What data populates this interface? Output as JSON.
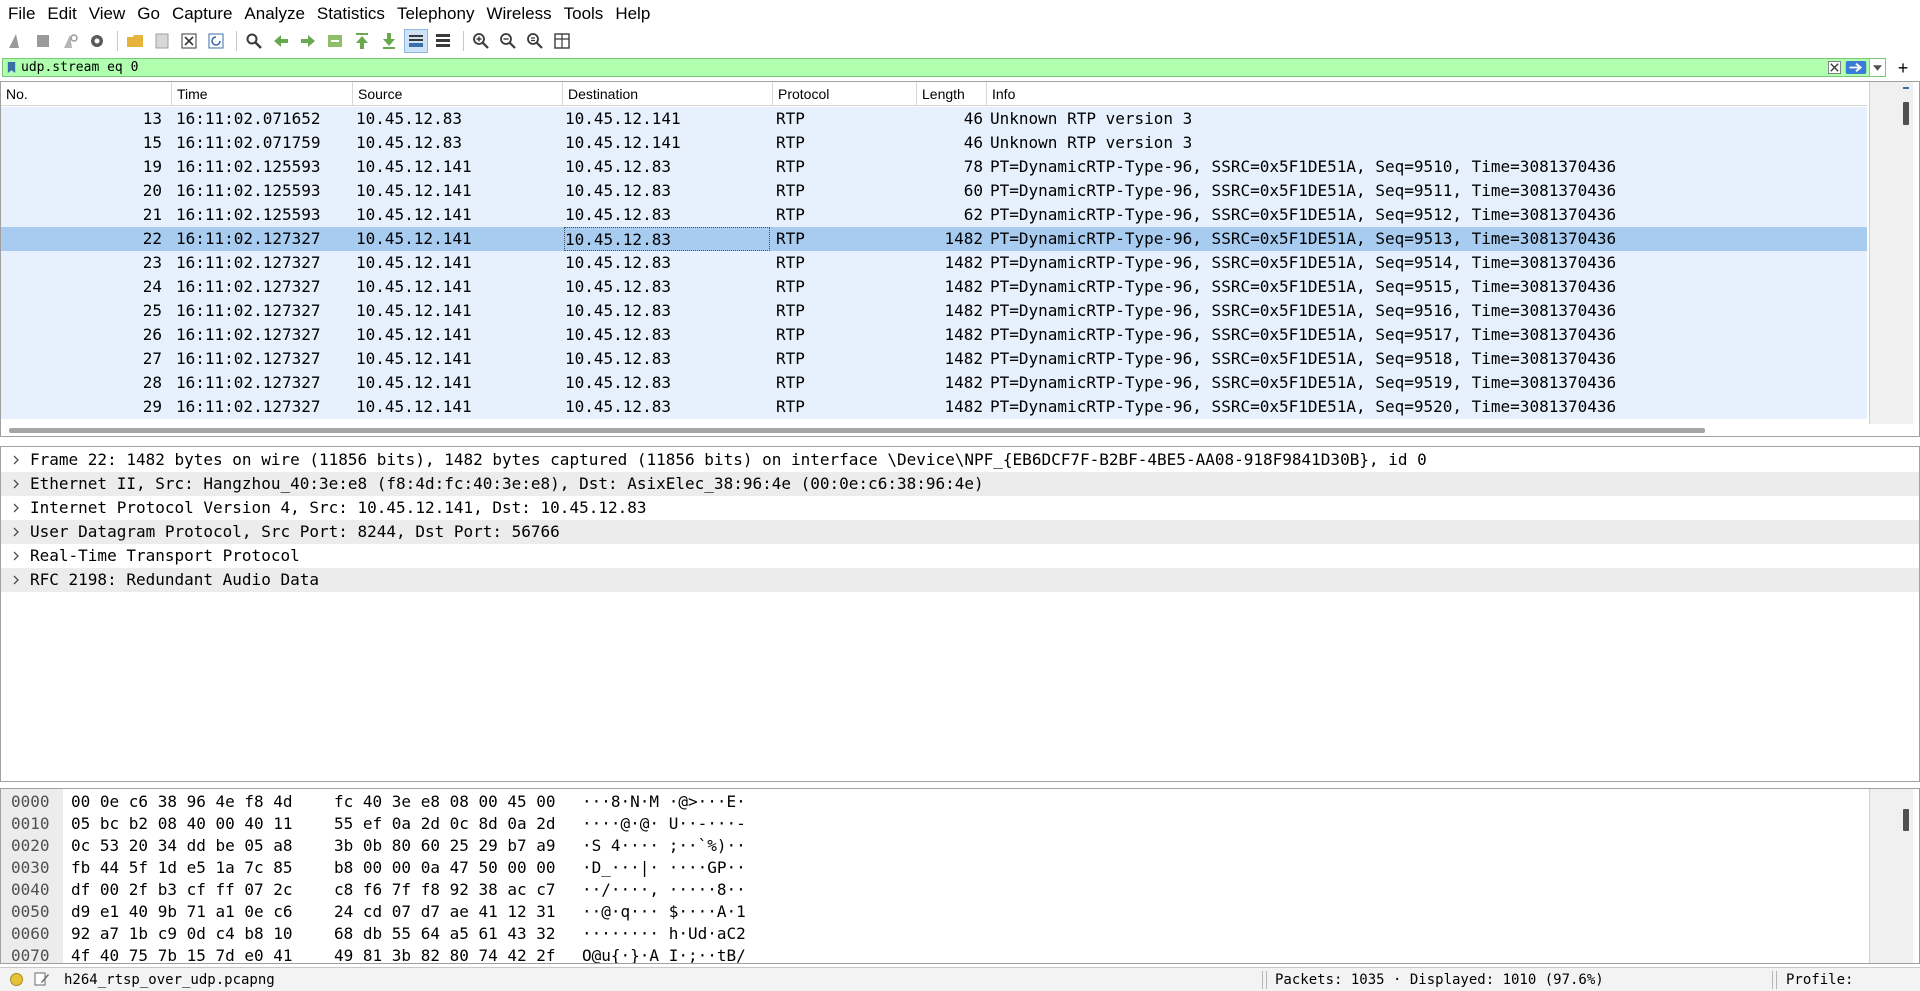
{
  "menu": [
    "File",
    "Edit",
    "View",
    "Go",
    "Capture",
    "Analyze",
    "Statistics",
    "Telephony",
    "Wireless",
    "Tools",
    "Help"
  ],
  "filter": {
    "value": "udp.stream eq 0"
  },
  "columns": {
    "no": "No.",
    "time": "Time",
    "source": "Source",
    "destination": "Destination",
    "protocol": "Protocol",
    "length": "Length",
    "info": "Info"
  },
  "packets": [
    {
      "no": "13",
      "time": "16:11:02.071652",
      "source": "10.45.12.83",
      "destination": "10.45.12.141",
      "protocol": "RTP",
      "length": "46",
      "info": "Unknown RTP version 3"
    },
    {
      "no": "15",
      "time": "16:11:02.071759",
      "source": "10.45.12.83",
      "destination": "10.45.12.141",
      "protocol": "RTP",
      "length": "46",
      "info": "Unknown RTP version 3"
    },
    {
      "no": "19",
      "time": "16:11:02.125593",
      "source": "10.45.12.141",
      "destination": "10.45.12.83",
      "protocol": "RTP",
      "length": "78",
      "info": "PT=DynamicRTP-Type-96, SSRC=0x5F1DE51A, Seq=9510, Time=3081370436"
    },
    {
      "no": "20",
      "time": "16:11:02.125593",
      "source": "10.45.12.141",
      "destination": "10.45.12.83",
      "protocol": "RTP",
      "length": "60",
      "info": "PT=DynamicRTP-Type-96, SSRC=0x5F1DE51A, Seq=9511, Time=3081370436"
    },
    {
      "no": "21",
      "time": "16:11:02.125593",
      "source": "10.45.12.141",
      "destination": "10.45.12.83",
      "protocol": "RTP",
      "length": "62",
      "info": "PT=DynamicRTP-Type-96, SSRC=0x5F1DE51A, Seq=9512, Time=3081370436"
    },
    {
      "no": "22",
      "time": "16:11:02.127327",
      "source": "10.45.12.141",
      "destination": "10.45.12.83",
      "protocol": "RTP",
      "length": "1482",
      "info": "PT=DynamicRTP-Type-96, SSRC=0x5F1DE51A, Seq=9513, Time=3081370436",
      "selected": true
    },
    {
      "no": "23",
      "time": "16:11:02.127327",
      "source": "10.45.12.141",
      "destination": "10.45.12.83",
      "protocol": "RTP",
      "length": "1482",
      "info": "PT=DynamicRTP-Type-96, SSRC=0x5F1DE51A, Seq=9514, Time=3081370436"
    },
    {
      "no": "24",
      "time": "16:11:02.127327",
      "source": "10.45.12.141",
      "destination": "10.45.12.83",
      "protocol": "RTP",
      "length": "1482",
      "info": "PT=DynamicRTP-Type-96, SSRC=0x5F1DE51A, Seq=9515, Time=3081370436"
    },
    {
      "no": "25",
      "time": "16:11:02.127327",
      "source": "10.45.12.141",
      "destination": "10.45.12.83",
      "protocol": "RTP",
      "length": "1482",
      "info": "PT=DynamicRTP-Type-96, SSRC=0x5F1DE51A, Seq=9516, Time=3081370436"
    },
    {
      "no": "26",
      "time": "16:11:02.127327",
      "source": "10.45.12.141",
      "destination": "10.45.12.83",
      "protocol": "RTP",
      "length": "1482",
      "info": "PT=DynamicRTP-Type-96, SSRC=0x5F1DE51A, Seq=9517, Time=3081370436"
    },
    {
      "no": "27",
      "time": "16:11:02.127327",
      "source": "10.45.12.141",
      "destination": "10.45.12.83",
      "protocol": "RTP",
      "length": "1482",
      "info": "PT=DynamicRTP-Type-96, SSRC=0x5F1DE51A, Seq=9518, Time=3081370436"
    },
    {
      "no": "28",
      "time": "16:11:02.127327",
      "source": "10.45.12.141",
      "destination": "10.45.12.83",
      "protocol": "RTP",
      "length": "1482",
      "info": "PT=DynamicRTP-Type-96, SSRC=0x5F1DE51A, Seq=9519, Time=3081370436"
    },
    {
      "no": "29",
      "time": "16:11:02.127327",
      "source": "10.45.12.141",
      "destination": "10.45.12.83",
      "protocol": "RTP",
      "length": "1482",
      "info": "PT=DynamicRTP-Type-96, SSRC=0x5F1DE51A, Seq=9520, Time=3081370436"
    }
  ],
  "details": [
    "Frame 22: 1482 bytes on wire (11856 bits), 1482 bytes captured (11856 bits) on interface \\Device\\NPF_{EB6DCF7F-B2BF-4BE5-AA08-918F9841D30B}, id 0",
    "Ethernet II, Src: Hangzhou_40:3e:e8 (f8:4d:fc:40:3e:e8), Dst: AsixElec_38:96:4e (00:0e:c6:38:96:4e)",
    "Internet Protocol Version 4, Src: 10.45.12.141, Dst: 10.45.12.83",
    "User Datagram Protocol, Src Port: 8244, Dst Port: 56766",
    "Real-Time Transport Protocol",
    "RFC 2198: Redundant Audio Data"
  ],
  "bytes": [
    {
      "offset": "0000",
      "hex1": "00 0e c6 38 96 4e f8 4d",
      "hex2": "fc 40 3e e8 08 00 45 00",
      "ascii": "···8·N·M ·@>···E·"
    },
    {
      "offset": "0010",
      "hex1": "05 bc b2 08 40 00 40 11",
      "hex2": "55 ef 0a 2d 0c 8d 0a 2d",
      "ascii": "····@·@· U··-···-"
    },
    {
      "offset": "0020",
      "hex1": "0c 53 20 34 dd be 05 a8",
      "hex2": "3b 0b 80 60 25 29 b7 a9",
      "ascii": "·S 4···· ;··`%)··"
    },
    {
      "offset": "0030",
      "hex1": "fb 44 5f 1d e5 1a 7c 85",
      "hex2": "b8 00 00 0a 47 50 00 00",
      "ascii": "·D_···|· ····GP··"
    },
    {
      "offset": "0040",
      "hex1": "df 00 2f b3 cf ff 07 2c",
      "hex2": "c8 f6 7f f8 92 38 ac c7",
      "ascii": "··/····, ·····8··"
    },
    {
      "offset": "0050",
      "hex1": "d9 e1 40 9b 71 a1 0e c6",
      "hex2": "24 cd 07 d7 ae 41 12 31",
      "ascii": "··@·q··· $····A·1"
    },
    {
      "offset": "0060",
      "hex1": "92 a7 1b c9 0d c4 b8 10",
      "hex2": "68 db 55 64 a5 61 43 32",
      "ascii": "········ h·Ud·aC2"
    },
    {
      "offset": "0070",
      "hex1": "4f 40 75 7b 15 7d e0 41",
      "hex2": "49 81 3b 82 80 74 42 2f",
      "ascii": "O@u{·}·A I·;··tB/"
    }
  ],
  "status": {
    "file": "h264_rtsp_over_udp.pcapng",
    "packets": "Packets: 1035 · Displayed: 1010 (97.6%)",
    "profile": "Profile: Default"
  },
  "colors": {
    "filter_ok": "#afffaf",
    "row_bg": "#e7f1fd",
    "row_selected": "#a8cbf0"
  }
}
